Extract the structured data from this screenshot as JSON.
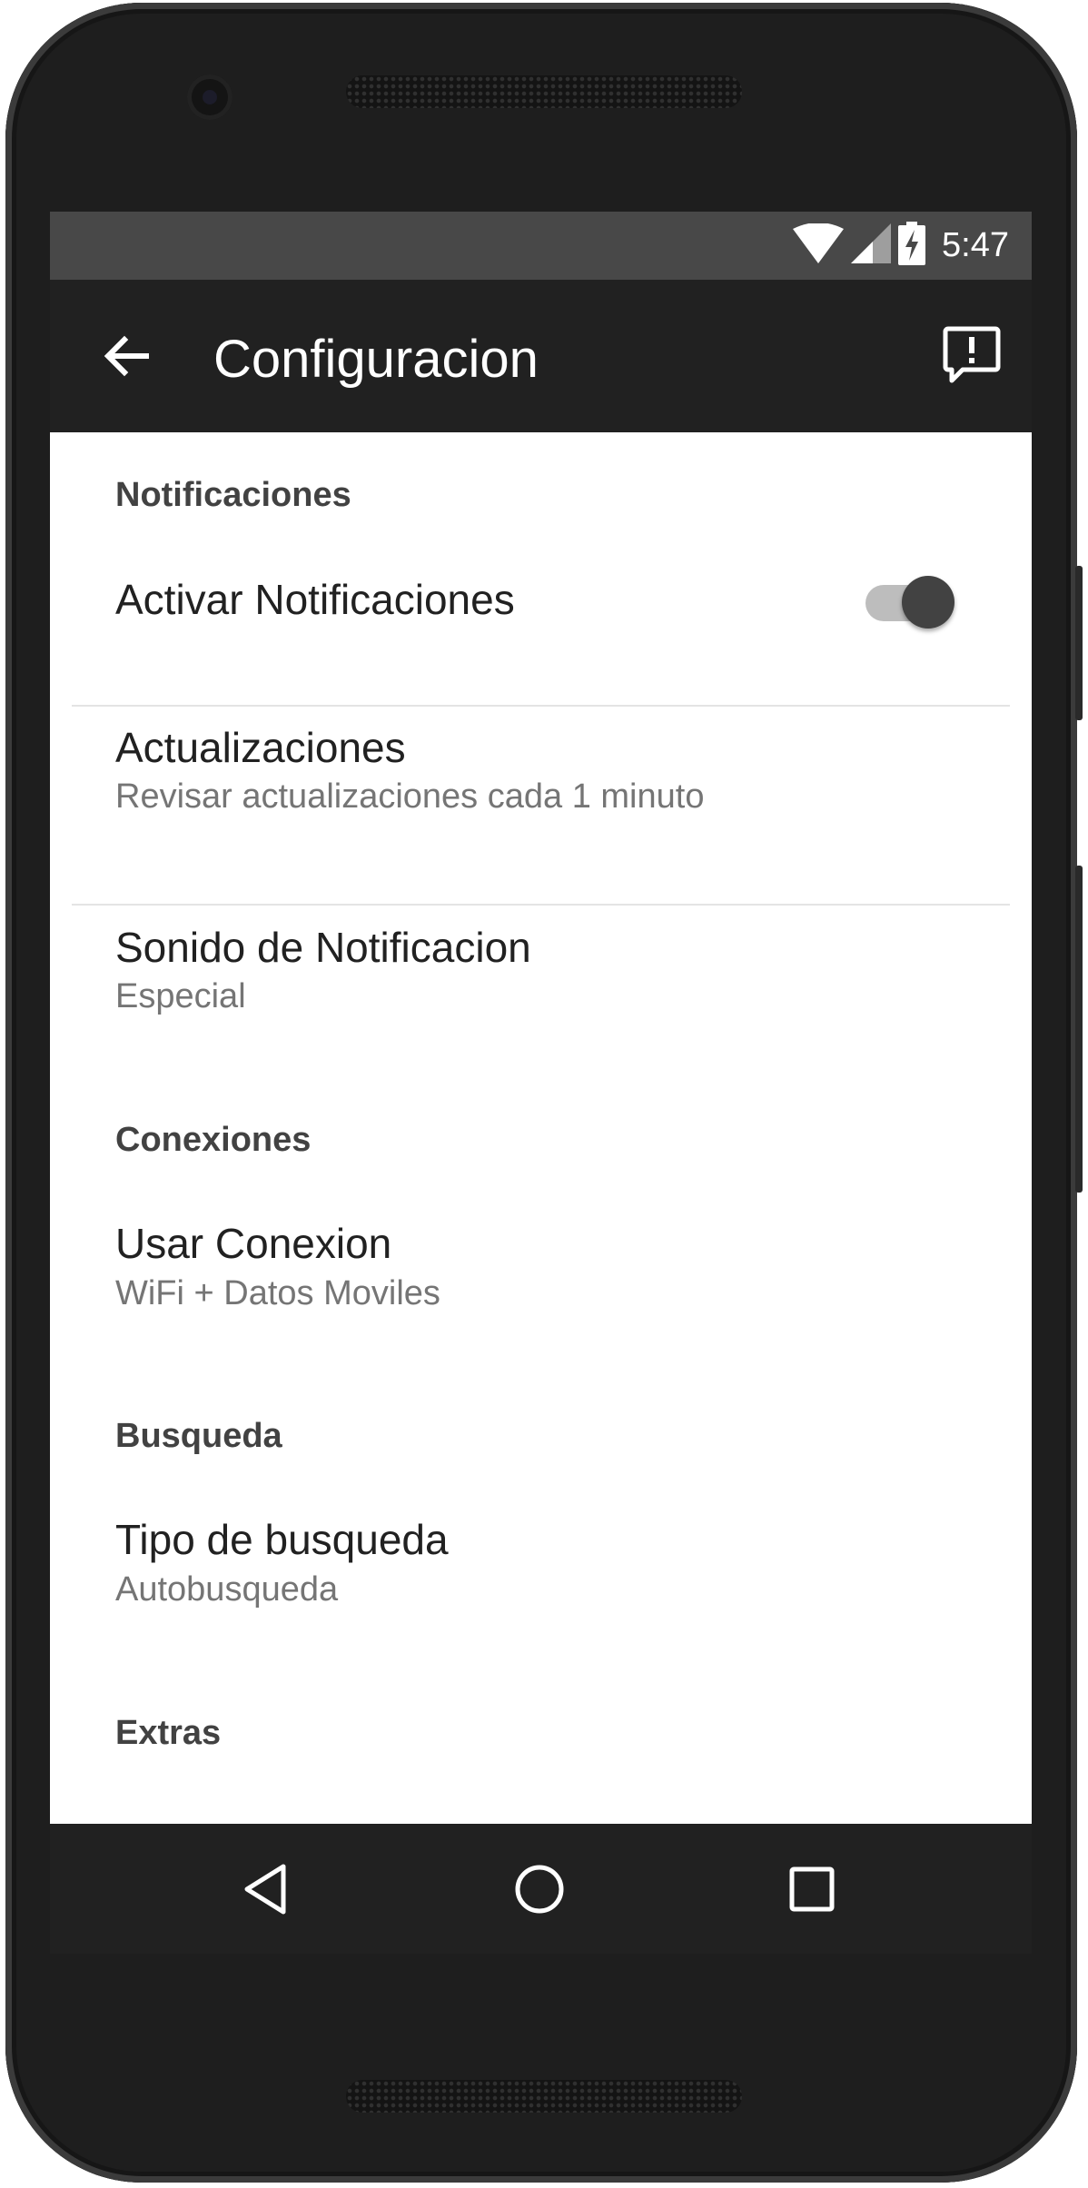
{
  "colors": {
    "status_bar": "#484848",
    "app_bar": "#212121",
    "background": "#ffffff",
    "section_header_text": "#424242",
    "primary_text": "#212121",
    "secondary_text": "#757575",
    "switch_thumb": "#424242",
    "switch_track": "#bdbdbd"
  },
  "status_bar": {
    "time": "5:47",
    "icons": [
      "wifi-icon",
      "cell-signal-icon",
      "battery-charging-icon"
    ]
  },
  "app_bar": {
    "title": "Configuracion",
    "back_icon": "arrow-back-icon",
    "action_icon": "feedback-icon"
  },
  "sections": [
    {
      "header": "Notificaciones",
      "items": [
        {
          "title": "Activar Notificaciones",
          "switch_on": true
        },
        {
          "title": "Actualizaciones",
          "summary": "Revisar actualizaciones cada 1 minuto"
        },
        {
          "title": "Sonido de Notificacion",
          "summary": "Especial"
        }
      ]
    },
    {
      "header": "Conexiones",
      "items": [
        {
          "title": "Usar Conexion",
          "summary": "WiFi + Datos Moviles"
        }
      ]
    },
    {
      "header": "Busqueda",
      "items": [
        {
          "title": "Tipo de busqueda",
          "summary": "Autobusqueda"
        }
      ]
    },
    {
      "header": "Extras",
      "items": []
    }
  ],
  "nav_bar": {
    "icons": [
      "back-triangle-icon",
      "home-circle-icon",
      "recents-square-icon"
    ]
  }
}
